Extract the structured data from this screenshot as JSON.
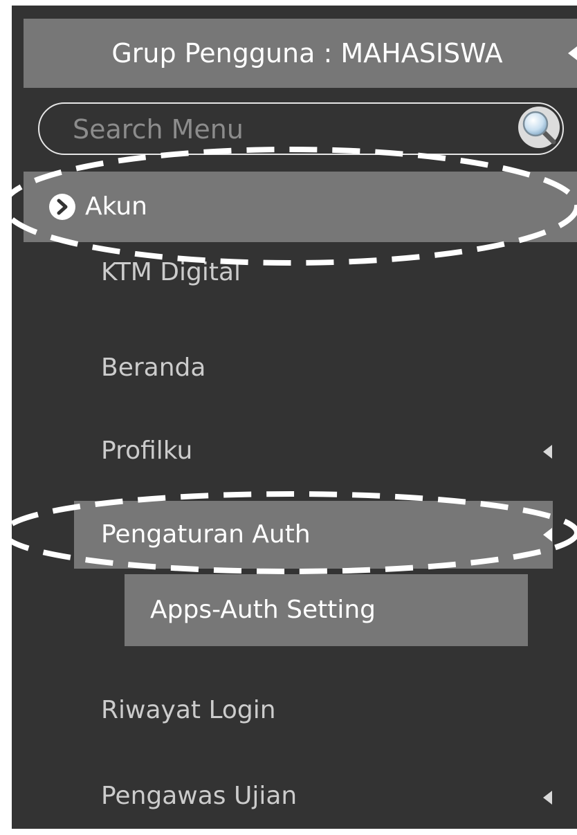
{
  "sidebar": {
    "group_label": "Grup Pengguna : MAHASISWA",
    "search": {
      "placeholder": "Search Menu"
    },
    "items": [
      {
        "label": "Akun",
        "icon": "chevron-right-circle-icon",
        "active": true
      },
      {
        "label": "KTM Digital"
      },
      {
        "label": "Beranda"
      },
      {
        "label": "Profilku",
        "has_submenu": true
      },
      {
        "label": "Pengaturan Auth",
        "has_submenu": true,
        "expanded": true,
        "children": [
          {
            "label": "Apps-Auth Setting"
          }
        ]
      },
      {
        "label": "Riwayat Login"
      },
      {
        "label": "Pengawas Ujian",
        "has_submenu": true
      }
    ]
  },
  "colors": {
    "sidebar_bg": "#333333",
    "highlight_bg": "#777777",
    "text": "#cccccc",
    "text_active": "#ffffff",
    "annotation": "#ffffff"
  }
}
